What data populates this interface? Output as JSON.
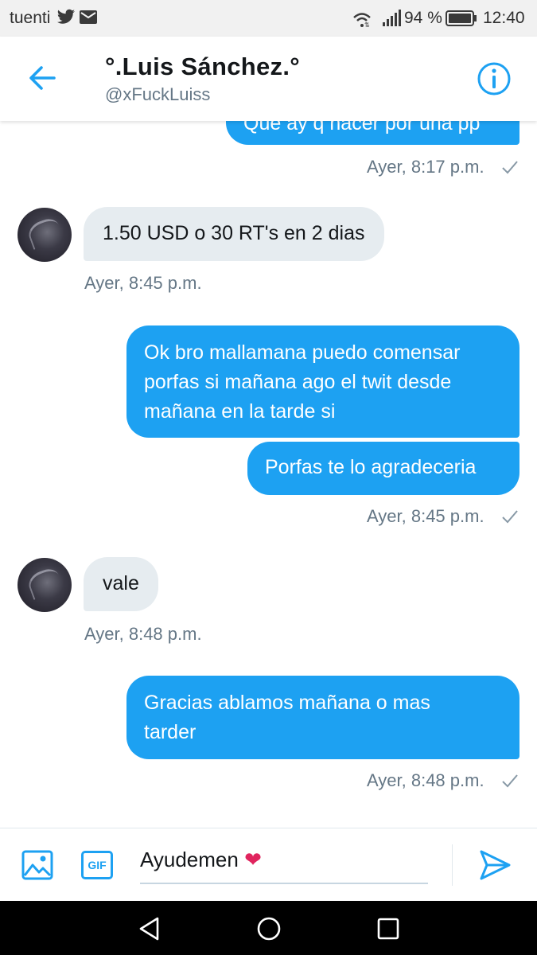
{
  "status_bar": {
    "carrier": "tuenti",
    "battery_percent": "94 %",
    "time": "12:40"
  },
  "header": {
    "title": "°.Luis Sánchez.°",
    "handle": "@xFuckLuiss"
  },
  "messages": [
    {
      "direction": "out",
      "text": "Que ay q hacer por una pp",
      "timestamp": "Ayer, 8:17 p.m."
    },
    {
      "direction": "in",
      "text": "1.50 USD o 30 RT's en 2 dias",
      "timestamp": "Ayer, 8:45 p.m."
    },
    {
      "direction": "out",
      "lines": [
        "Ok bro mallamana puedo comensar",
        "porfas si mañana ago el twit desde",
        "mañana en la tarde si"
      ]
    },
    {
      "direction": "out",
      "text": "Porfas te lo agradeceria",
      "timestamp": "Ayer, 8:45 p.m."
    },
    {
      "direction": "in",
      "text": "vale",
      "timestamp": "Ayer, 8:48 p.m."
    },
    {
      "direction": "out",
      "lines": [
        "Gracias ablamos mañana o mas",
        "tarder"
      ],
      "timestamp": "Ayer, 8:48 p.m."
    }
  ],
  "compose": {
    "value": "Ayudemen",
    "emoji": "❤",
    "gif_label": "GIF"
  },
  "colors": {
    "accent": "#1da1f2",
    "incoming_bubble": "#e6ecf0",
    "timestamp": "#657786",
    "heart": "#e0245e"
  },
  "icons": [
    "back-arrow-icon",
    "info-icon",
    "image-icon",
    "gif-icon",
    "send-icon",
    "check-icon",
    "nav-back-icon",
    "nav-home-icon",
    "nav-recents-icon"
  ]
}
